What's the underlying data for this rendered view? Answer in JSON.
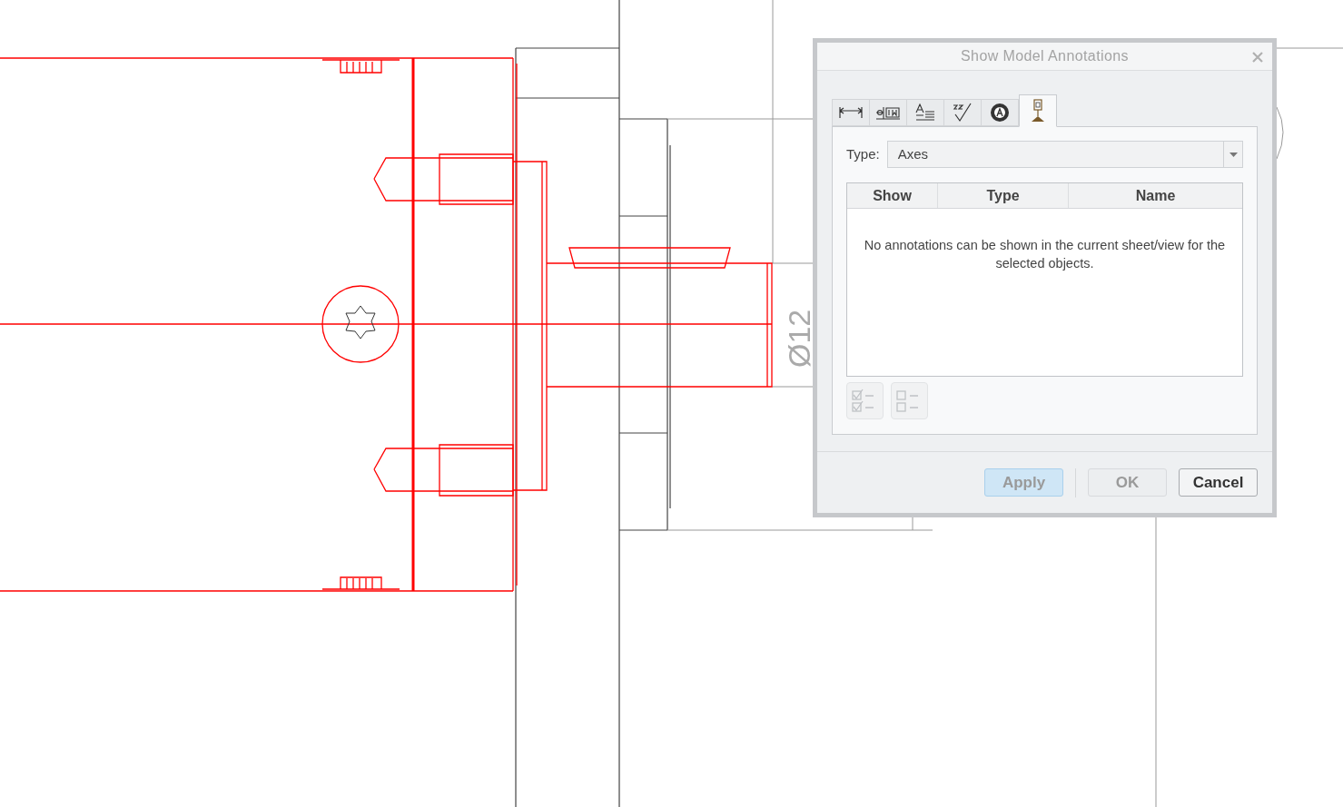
{
  "drawing": {
    "dimension_text": "Ø12"
  },
  "dialog": {
    "title": "Show Model Annotations",
    "tabs": [
      {
        "kind": "dimension",
        "selected": false
      },
      {
        "kind": "geometric-tolerance",
        "selected": false
      },
      {
        "kind": "note",
        "selected": false
      },
      {
        "kind": "surface-finish",
        "selected": false
      },
      {
        "kind": "symbol",
        "selected": false
      },
      {
        "kind": "datum",
        "selected": true
      }
    ],
    "type_label": "Type:",
    "type_value": "Axes",
    "table": {
      "columns": [
        "Show",
        "Type",
        "Name"
      ],
      "empty_message": "No annotations can be shown in the current sheet/view for the selected objects."
    },
    "list_buttons": [
      {
        "kind": "select-all",
        "disabled": true
      },
      {
        "kind": "deselect-all",
        "disabled": true
      }
    ],
    "buttons": [
      {
        "label": "Apply",
        "disabled": true,
        "highlighted": true
      },
      {
        "label": "OK",
        "disabled": true,
        "highlighted": false
      },
      {
        "label": "Cancel",
        "disabled": false,
        "highlighted": false
      }
    ]
  }
}
